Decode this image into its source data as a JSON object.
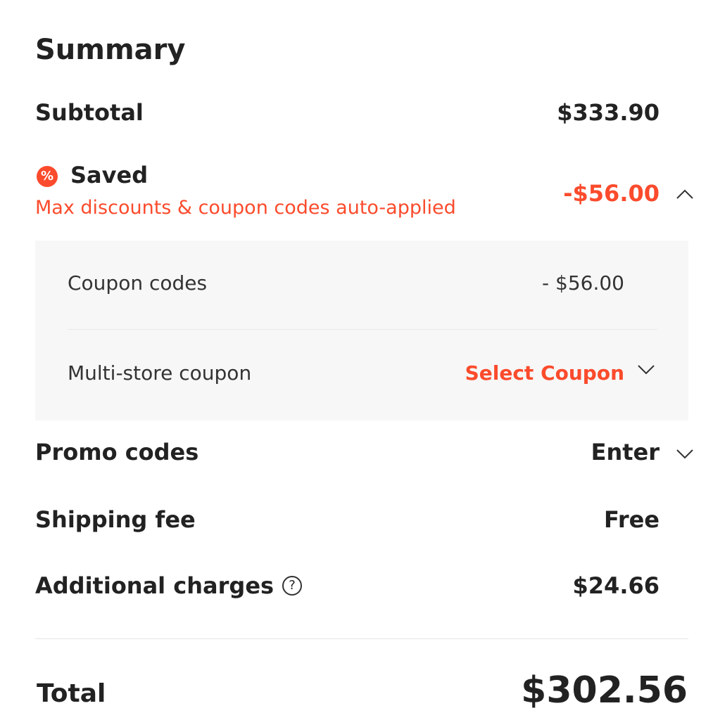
{
  "summary": {
    "title": "Summary",
    "subtotal_label": "Subtotal",
    "subtotal_value": "$333.90",
    "saved_label": "Saved",
    "saved_value": "-$56.00",
    "saved_subtext": "Max discounts & coupon codes auto-applied",
    "coupon_codes_label": "Coupon codes",
    "coupon_codes_value": "- $56.00",
    "multi_store_label": "Multi-store coupon",
    "select_coupon_label": "Select Coupon",
    "promo_label": "Promo codes",
    "promo_action": "Enter",
    "shipping_label": "Shipping fee",
    "shipping_value": "Free",
    "additional_label": "Additional charges",
    "additional_value": "$24.66",
    "total_label": "Total",
    "total_value": "$302.56"
  },
  "icons": {
    "saved_icon": "coupon-percent-icon",
    "collapse_icon": "chevron-up-icon",
    "select_icon": "chevron-down-icon",
    "promo_icon": "chevron-down-icon",
    "info_icon": "question-circle-icon"
  },
  "colors": {
    "accent": "#fb4b2c",
    "text": "#222222",
    "panel_bg": "#f7f7f7"
  }
}
